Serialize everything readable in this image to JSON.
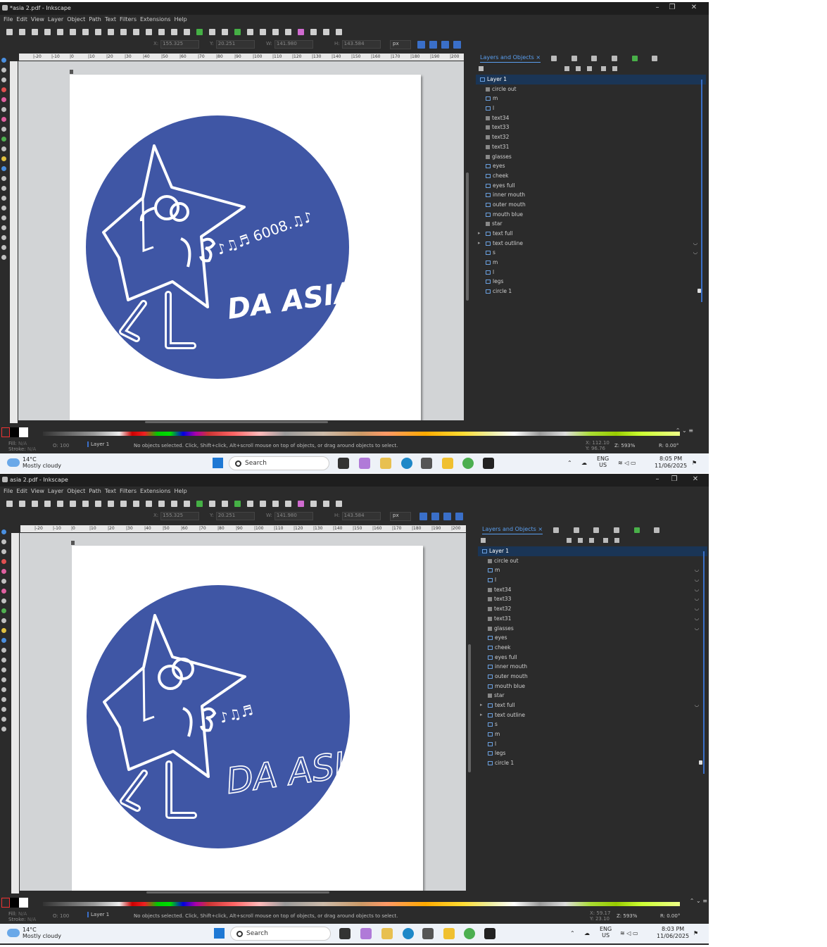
{
  "screenshots": [
    {
      "window_title": "*asia 2.pdf - Inkscape",
      "x_field": "155.325",
      "y_field": "20.251",
      "w_field": "141.980",
      "h_field": "143.584",
      "unit": "px",
      "status_layer": "Layer 1",
      "cursor_x": "112.10",
      "cursor_y": "96.76",
      "zoom": "593%",
      "rotation": "0.00°",
      "clock_time": "8:05 PM",
      "clock_date": "11/06/2025",
      "artwork_notes": "♪♫♬ 6008.♫♪"
    },
    {
      "window_title": "asia 2.pdf - Inkscape",
      "x_field": "155.325",
      "y_field": "20.251",
      "w_field": "141.980",
      "h_field": "143.584",
      "unit": "px",
      "status_layer": "Layer 1",
      "cursor_x": "59.17",
      "cursor_y": "23.10",
      "zoom": "593%",
      "rotation": "0.00°",
      "clock_time": "8:03 PM",
      "clock_date": "11/06/2025",
      "artwork_notes": "♪♫♬"
    }
  ],
  "menu": [
    "File",
    "Edit",
    "View",
    "Layer",
    "Object",
    "Path",
    "Text",
    "Filters",
    "Extensions",
    "Help"
  ],
  "ctrl_labels": {
    "x": "X:",
    "y": "Y:",
    "w": "W:",
    "h": "H:"
  },
  "ruler_labels": [
    "|-20",
    "|-10",
    "|0",
    "|10",
    "|20",
    "|30",
    "|40",
    "|50",
    "|60",
    "|70",
    "|80",
    "|90",
    "|100",
    "|110",
    "|120",
    "|130",
    "|140",
    "|150",
    "|160",
    "|170",
    "|180",
    "|190",
    "|200",
    "|2"
  ],
  "panel": {
    "tab_label": "Layers and Objects",
    "tab_close": "×",
    "layer_name": "Layer 1",
    "items": [
      "circle out",
      "m",
      "l",
      "text34",
      "text33",
      "text32",
      "text31",
      "glasses",
      "eyes",
      "cheek",
      "eyes full",
      "inner mouth",
      "outer mouth",
      "mouth blue",
      "star",
      "text full",
      "text outline",
      "s",
      "m",
      "l",
      "legs",
      "circle 1"
    ]
  },
  "status": {
    "fill_label": "Fill:",
    "fill_value": "N/A",
    "stroke_label": "Stroke:",
    "stroke_value": "N/A",
    "opacity_label": "O:",
    "opacity_value": "100",
    "message": "No objects selected. Click, Shift+click, Alt+scroll mouse on top of objects, or drag around objects to select.",
    "x_label": "X:",
    "y_label": "Y:",
    "z_label": "Z:",
    "r_label": "R:"
  },
  "artwork": {
    "title": "DA ASIA",
    "circle_color": "#3f56a5"
  },
  "taskbar": {
    "temp": "14°C",
    "weather": "Mostly cloudy",
    "search": "Search",
    "lang1": "ENG",
    "lang2": "US"
  },
  "colors": {
    "accent": "#3a6fc8",
    "panel_bg": "#2b2b2b",
    "canvas_bg": "#d2d4d6"
  }
}
